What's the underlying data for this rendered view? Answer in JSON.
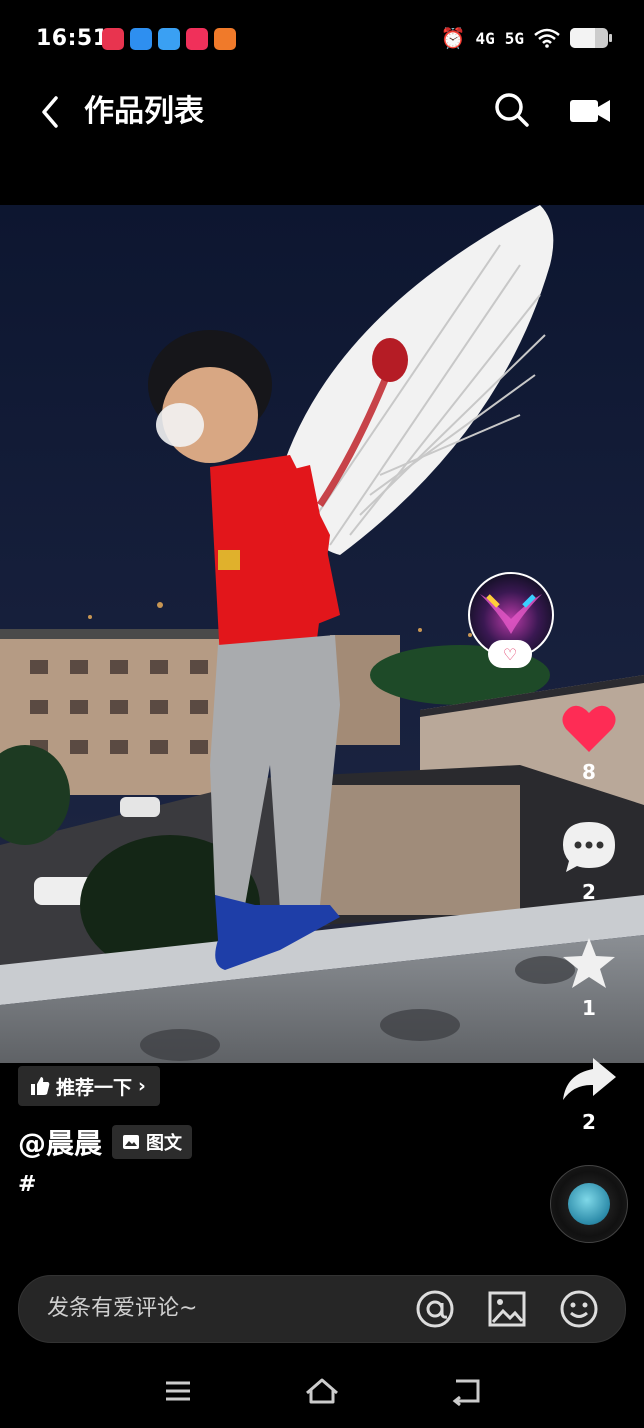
{
  "status_bar": {
    "time": "16:51",
    "app_icon_colors": [
      "#e8344f",
      "#2e8ff0",
      "#3aa0f3",
      "#f0305a",
      "#f07a2a"
    ],
    "signal_1": "4G",
    "signal_2": "5G",
    "battery_level": 0.65
  },
  "header": {
    "title": "作品列表"
  },
  "side_actions": {
    "like_count": "8",
    "comment_count": "2",
    "favorite_count": "1",
    "share_count": "2",
    "like_color": "#fe2c55"
  },
  "caption": {
    "recommend_label": "推荐一下",
    "author": "@晨晨",
    "tag_label": "图文",
    "hashtag": "#"
  },
  "comment_bar": {
    "placeholder": "发条有爱评论~"
  }
}
